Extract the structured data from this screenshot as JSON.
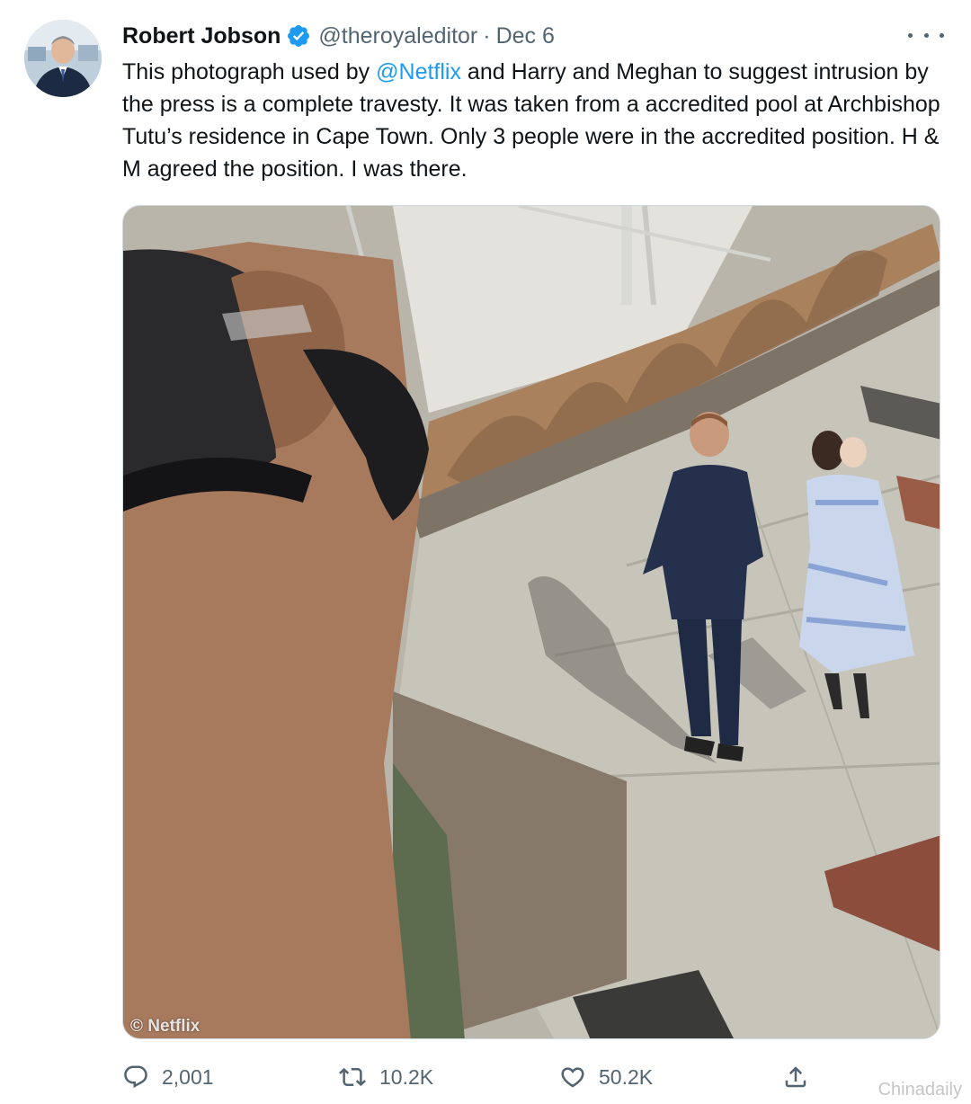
{
  "author": {
    "display_name": "Robert Jobson",
    "handle": "@theroyaleditor",
    "separator": "·",
    "date": "Dec 6"
  },
  "tweet": {
    "text_before": "This photograph used by ",
    "mention": "@Netflix",
    "text_after": " and Harry and Meghan to suggest intrusion by the press is a complete travesty. It was taken from a accredited pool at Archbishop Tutu’s residence in Cape Town. Only 3 people were in the accredited position. H & M agreed the position. I was there."
  },
  "media": {
    "watermark": "© Netflix"
  },
  "actions": {
    "replies": "2,001",
    "retweets": "10.2K",
    "likes": "50.2K"
  },
  "corner_watermark": "Chinadaily",
  "colors": {
    "accent": "#1d9bf0",
    "muted": "#536471"
  },
  "icons": [
    "verified-badge-icon",
    "more-options-icon",
    "reply-icon",
    "retweet-icon",
    "like-icon",
    "share-icon"
  ]
}
